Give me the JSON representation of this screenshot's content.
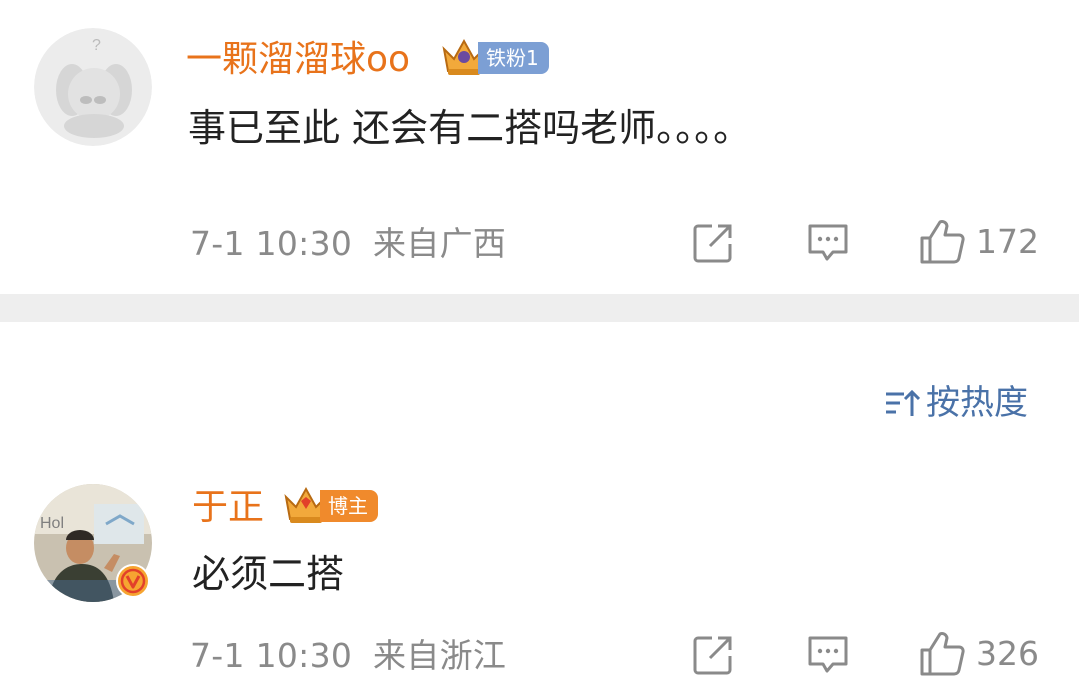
{
  "comments": [
    {
      "username": "一颗溜溜球oo",
      "badge_label": "铁粉1",
      "badge_color": "#7c9fd4",
      "avatar_icon": "default-dog-avatar-icon",
      "text": "事已至此 还会有二搭吗老师。。。。",
      "date": "7-1 10:30",
      "location": "来自广西",
      "likes": "172"
    },
    {
      "username": "于正",
      "badge_label": "博主",
      "badge_color": "#f08a2c",
      "avatar_icon": "user-photo-avatar",
      "verified_icon": "verified-v-icon",
      "text": "必须二搭",
      "date": "7-1 10:30",
      "location": "来自浙江",
      "likes": "326"
    }
  ],
  "sort_label": "按热度",
  "colors": {
    "username": "#e8731b",
    "meta": "#8a8a8a",
    "sort": "#4a72a8",
    "divider": "#eeeeee"
  },
  "icons": [
    "share-icon",
    "comment-icon",
    "like-icon",
    "sort-icon"
  ]
}
